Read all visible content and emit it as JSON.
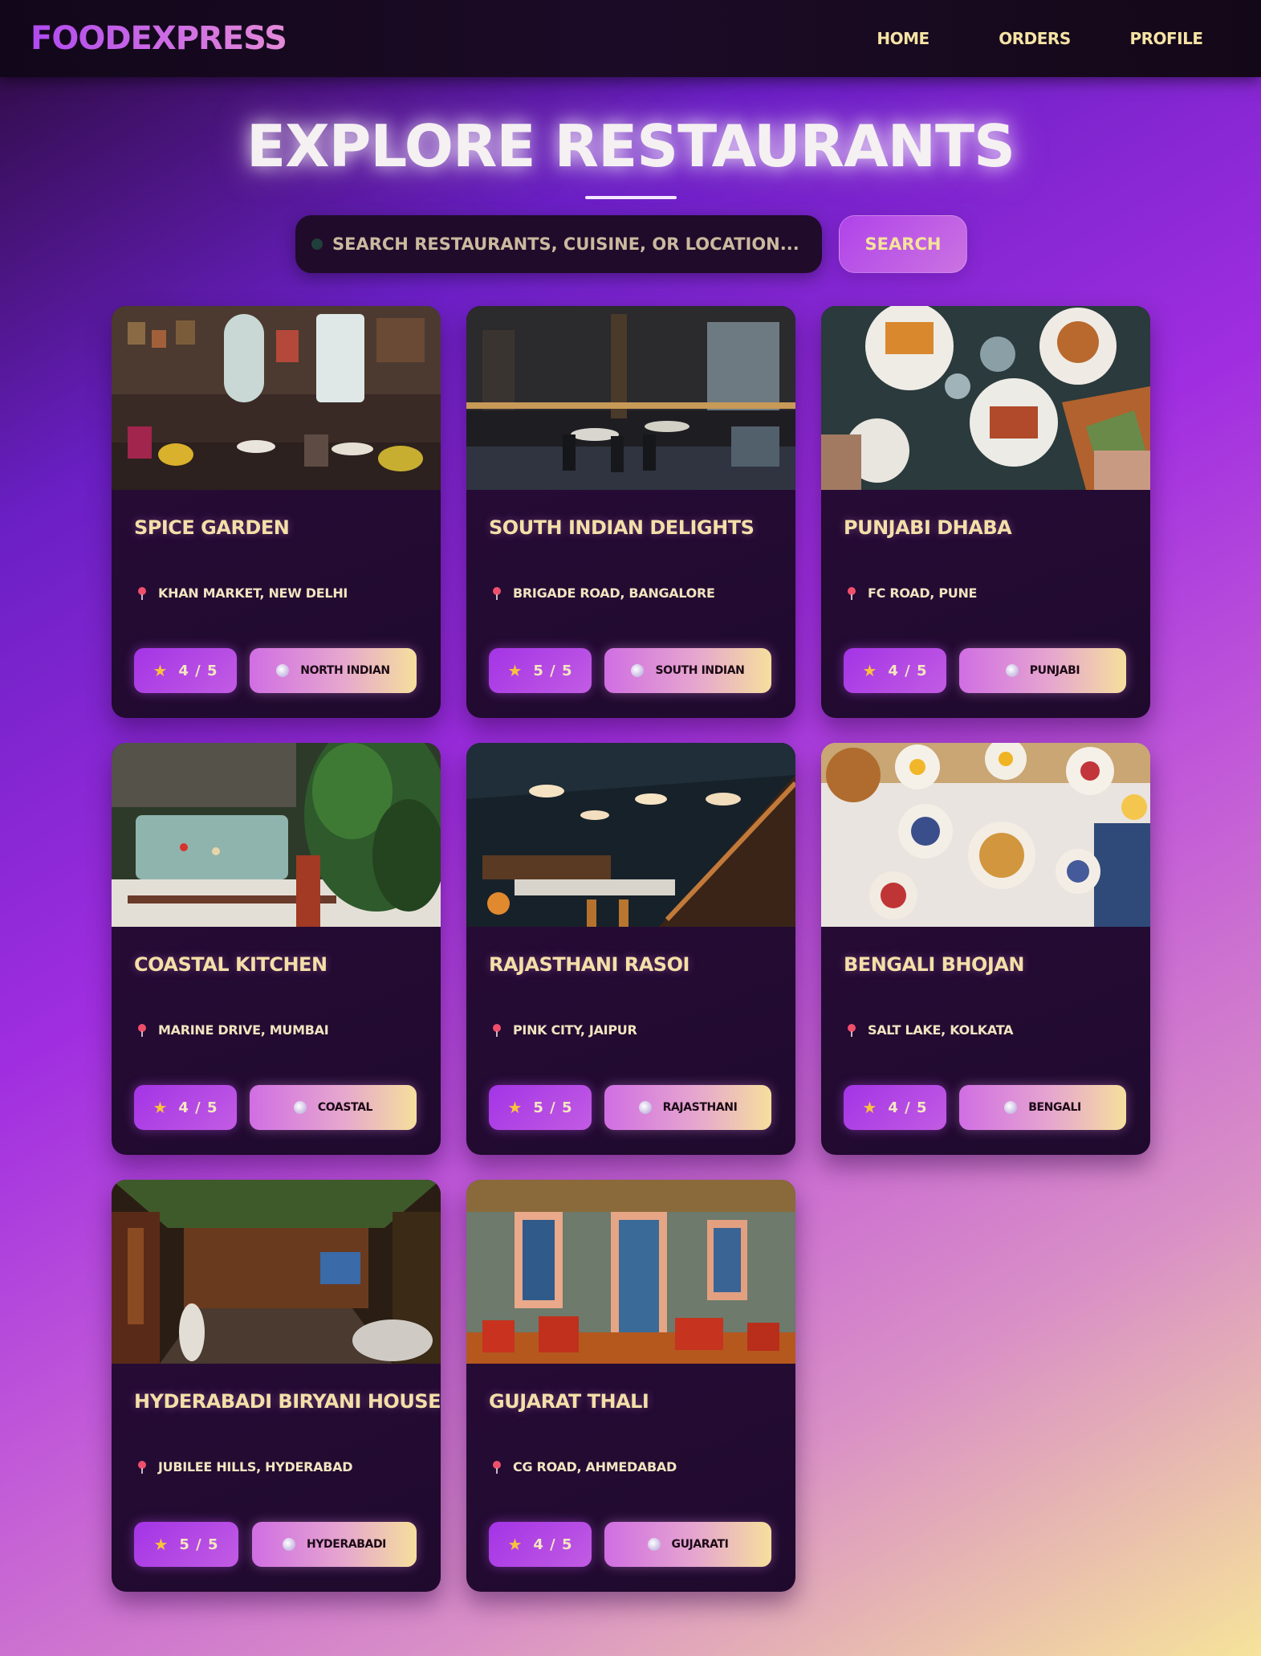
{
  "header": {
    "logo": "FOODEXPRESS",
    "nav": [
      "HOME",
      "ORDERS",
      "PROFILE"
    ]
  },
  "hero": {
    "title": "EXPLORE RESTAURANTS"
  },
  "search": {
    "placeholder": "SEARCH RESTAURANTS, CUISINE, OR LOCATION...",
    "button_label": "SEARCH"
  },
  "icons": {
    "location": "map-pin-icon",
    "rating": "star-icon",
    "cuisine": "disc-icon"
  },
  "colors": {
    "accent_purple": "#a434e6",
    "cream_text": "#f4dfa8",
    "card_bg": "#220b30",
    "star": "#f7c43b",
    "pin": "#ef4f6b"
  },
  "restaurants": [
    {
      "name": "SPICE GARDEN",
      "location": "KHAN MARKET, NEW DELHI",
      "rating": "4 / 5",
      "cuisine": "NORTH INDIAN",
      "image": "cafe-interior-photo"
    },
    {
      "name": "SOUTH INDIAN DELIGHTS",
      "location": "BRIGADE ROAD, BANGALORE",
      "rating": "5 / 5",
      "cuisine": "SOUTH INDIAN",
      "image": "modern-restaurant-photo"
    },
    {
      "name": "PUNJABI DHABA",
      "location": "FC ROAD, PUNE",
      "rating": "4 / 5",
      "cuisine": "PUNJABI",
      "image": "food-table-photo"
    },
    {
      "name": "COASTAL KITCHEN",
      "location": "MARINE DRIVE, MUMBAI",
      "rating": "4 / 5",
      "cuisine": "COASTAL",
      "image": "plant-dining-photo"
    },
    {
      "name": "RAJASTHANI RASOI",
      "location": "PINK CITY, JAIPUR",
      "rating": "5 / 5",
      "cuisine": "RAJASTHANI",
      "image": "bar-interior-photo"
    },
    {
      "name": "BENGALI BHOJAN",
      "location": "SALT LAKE, KOLKATA",
      "rating": "4 / 5",
      "cuisine": "BENGALI",
      "image": "brunch-spread-photo"
    },
    {
      "name": "HYDERABADI BIRYANI HOUSE",
      "location": "JUBILEE HILLS, HYDERABAD",
      "rating": "5 / 5",
      "cuisine": "HYDERABADI",
      "image": "lounge-interior-photo"
    },
    {
      "name": "GUJARAT THALI",
      "location": "CG ROAD, AHMEDABAD",
      "rating": "4 / 5",
      "cuisine": "GUJARATI",
      "image": "street-cafe-photo"
    }
  ]
}
